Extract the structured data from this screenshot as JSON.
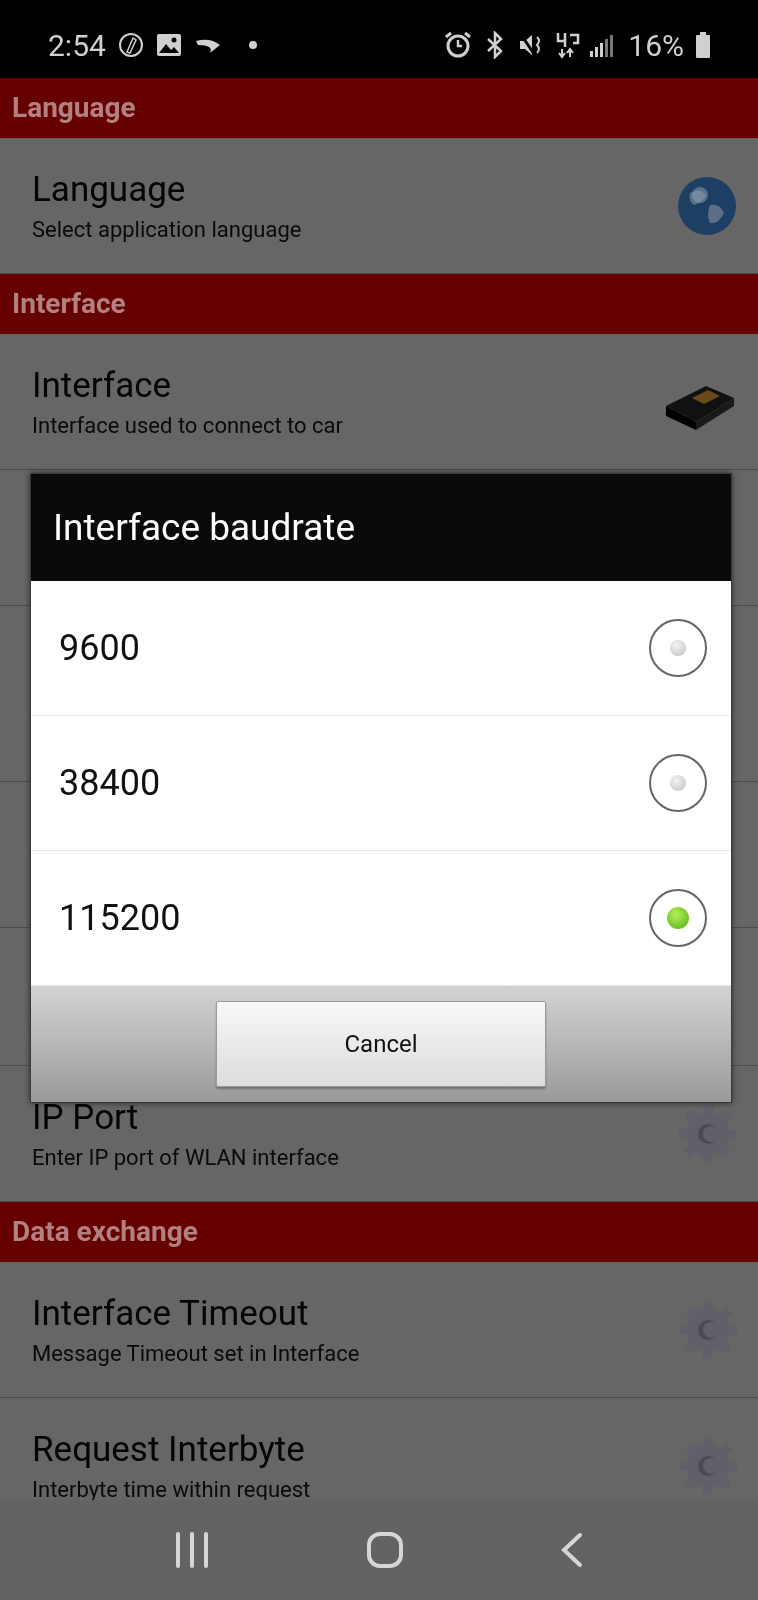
{
  "status_bar": {
    "time": "2:54",
    "battery": "16%"
  },
  "sections": [
    {
      "title": "Language",
      "items": [
        {
          "title": "Language",
          "subtitle": "Select application language",
          "kind": "globe"
        }
      ]
    },
    {
      "title": "Interface",
      "items": [
        {
          "title": "Interface",
          "subtitle": "Interface used to connect to car",
          "kind": "adapter"
        },
        {
          "title": "IP Port",
          "subtitle": "Enter IP port of WLAN interface",
          "kind": "gear"
        }
      ]
    },
    {
      "title": "Data exchange",
      "items": [
        {
          "title": "Interface Timeout",
          "subtitle": "Message Timeout set in Interface",
          "kind": "gear"
        },
        {
          "title": "Request Interbyte",
          "subtitle": "Interbyte time within request",
          "kind": "gear"
        }
      ]
    }
  ],
  "dialog": {
    "title": "Interface baudrate",
    "options": [
      {
        "label": "9600",
        "selected": false
      },
      {
        "label": "38400",
        "selected": false
      },
      {
        "label": "115200",
        "selected": true
      }
    ],
    "button": "Cancel"
  }
}
